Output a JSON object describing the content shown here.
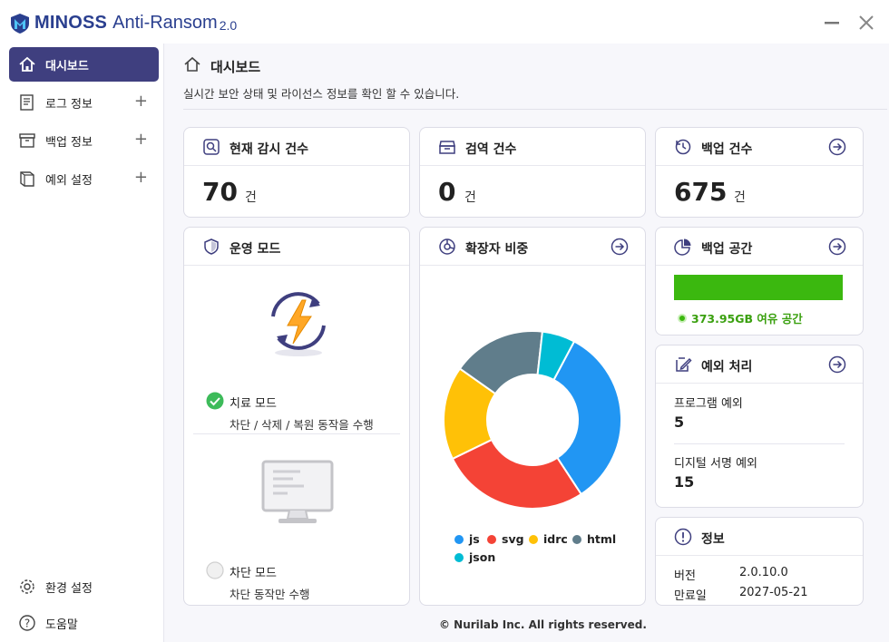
{
  "app": {
    "brand": "MINOSS",
    "product": "Anti-Ransom",
    "version": "2.0"
  },
  "window": {
    "minimize": "—",
    "close": "✕"
  },
  "sidebar": {
    "items": [
      {
        "label": "대시보드",
        "icon": "home-icon",
        "active": true
      },
      {
        "label": "로그 정보",
        "icon": "log-icon",
        "expand": "+"
      },
      {
        "label": "백업 정보",
        "icon": "backup-box-icon",
        "expand": "+"
      },
      {
        "label": "예외 설정",
        "icon": "exception-book-icon",
        "expand": "+"
      }
    ],
    "bottom": [
      {
        "label": "환경 설정",
        "icon": "gear-icon"
      },
      {
        "label": "도움말",
        "icon": "help-icon"
      }
    ]
  },
  "page": {
    "title": "대시보드",
    "subtitle": "실시간 보안 상태 및 라이선스 정보를 확인 할 수 있습니다."
  },
  "cards": {
    "monitor": {
      "title": "현재 감시 건수",
      "value": "70",
      "unit": "건"
    },
    "detect": {
      "title": "검역 건수",
      "value": "0",
      "unit": "건"
    },
    "backup_count": {
      "title": "백업 건수",
      "value": "675",
      "unit": "건"
    },
    "mode": {
      "title": "운영 모드",
      "cure_label": "치료 모드",
      "cure_desc": "차단 / 삭제 / 복원 동작을 수행",
      "cure_selected": true,
      "block_label": "차단 모드",
      "block_desc": "차단 동작만 수행",
      "block_selected": false
    },
    "extension": {
      "title": "확장자 비중"
    },
    "backup_space": {
      "title": "백업 공간",
      "free_text": "373.95GB 여유 공간",
      "used_fraction": 1.0
    },
    "exceptions": {
      "title": "예외 처리",
      "program_label": "프로그램 예외",
      "program_value": "5",
      "signature_label": "디지털 서명 예외",
      "signature_value": "15"
    },
    "info": {
      "title": "정보",
      "version_label": "버전",
      "version_value": "2.0.10.0",
      "expire_label": "만료일",
      "expire_value": "2027-05-21"
    }
  },
  "chart_data": {
    "type": "pie",
    "variant": "donut",
    "title": "",
    "categories": [
      "js",
      "svg",
      "idrc",
      "html",
      "json"
    ],
    "values": [
      33,
      27,
      17,
      17,
      6
    ],
    "colors": [
      "#2196f3",
      "#f44336",
      "#ffc107",
      "#607d8b",
      "#00bcd4"
    ],
    "legend": "bottom"
  },
  "footer": {
    "copyright": "© Nurilab Inc. All rights reserved."
  },
  "colors": {
    "accent": "#3f3f7f",
    "brand": "#2a3f8f",
    "progress": "#3bb80f",
    "check": "#3dbb5a"
  }
}
